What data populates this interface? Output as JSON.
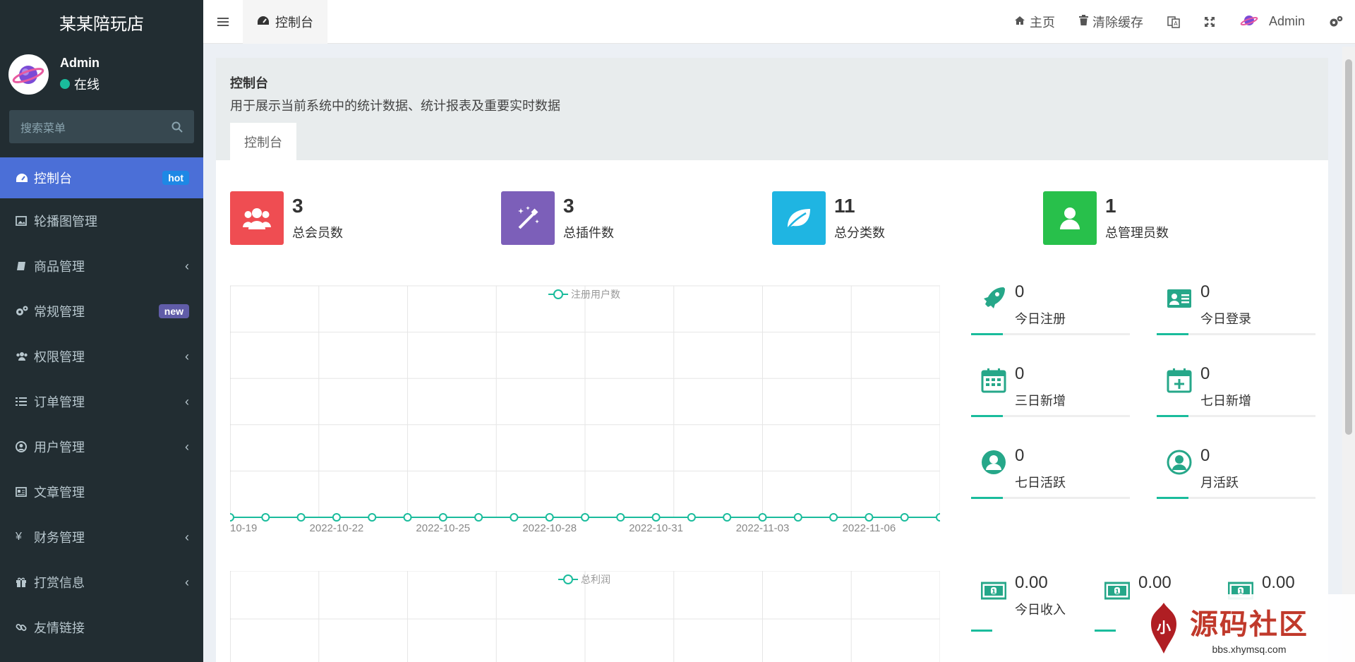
{
  "app": {
    "title": "某某陪玩店"
  },
  "user": {
    "name": "Admin",
    "status": "在线"
  },
  "search": {
    "placeholder": "搜索菜单"
  },
  "sidebar": {
    "items": [
      {
        "label": "控制台",
        "badge": "hot",
        "icon": "dashboard-icon",
        "active": true
      },
      {
        "label": "轮播图管理",
        "icon": "image-icon"
      },
      {
        "label": "商品管理",
        "icon": "book-icon",
        "chevron": "‹"
      },
      {
        "label": "常规管理",
        "badge": "new",
        "icon": "cogs-icon"
      },
      {
        "label": "权限管理",
        "icon": "users-icon",
        "chevron": "‹"
      },
      {
        "label": "订单管理",
        "icon": "list-icon",
        "chevron": "‹"
      },
      {
        "label": "用户管理",
        "icon": "user-circle-icon",
        "chevron": "‹"
      },
      {
        "label": "文章管理",
        "icon": "newspaper-icon"
      },
      {
        "label": "财务管理",
        "icon": "yen-icon",
        "chevron": "‹"
      },
      {
        "label": "打赏信息",
        "icon": "gift-icon",
        "chevron": "‹"
      },
      {
        "label": "友情链接",
        "icon": "link-icon"
      }
    ]
  },
  "topbar": {
    "tab": "控制台",
    "home": "主页",
    "clear_cache": "清除缓存",
    "user": "Admin"
  },
  "page": {
    "title": "控制台",
    "description": "用于展示当前系统中的统计数据、统计报表及重要实时数据",
    "inner_tab": "控制台"
  },
  "stats": [
    {
      "value": "3",
      "label": "总会员数",
      "color": "#dd4b39",
      "icon": "users-icon"
    },
    {
      "value": "3",
      "label": "总插件数",
      "color": "#605ca8",
      "icon": "magic-icon"
    },
    {
      "value": "11",
      "label": "总分类数",
      "color": "#00a7d0",
      "icon": "leaf-icon"
    },
    {
      "value": "1",
      "label": "总管理员数",
      "color": "#00a65a",
      "icon": "user-icon"
    }
  ],
  "mini_stats": [
    {
      "value": "0",
      "label": "今日注册",
      "icon": "rocket-icon"
    },
    {
      "value": "0",
      "label": "今日登录",
      "icon": "id-card-icon"
    },
    {
      "value": "0",
      "label": "三日新增",
      "icon": "calendar-icon"
    },
    {
      "value": "0",
      "label": "七日新增",
      "icon": "calendar-plus-icon"
    },
    {
      "value": "0",
      "label": "七日活跃",
      "icon": "user-circle-icon"
    },
    {
      "value": "0",
      "label": "月活跃",
      "icon": "user-circle-o-icon"
    }
  ],
  "money_stats": [
    {
      "value": "0.00",
      "label": "今日收入",
      "icon": "money-icon"
    },
    {
      "value": "0.00",
      "label": "",
      "icon": "money-icon"
    },
    {
      "value": "0.00",
      "label": "",
      "icon": "money-icon"
    }
  ],
  "chart_data": [
    {
      "type": "line",
      "legend": "注册用户数",
      "series": [
        {
          "name": "注册用户数",
          "values": [
            0,
            0,
            0,
            0,
            0,
            0,
            0,
            0,
            0,
            0,
            0,
            0,
            0,
            0,
            0,
            0,
            0,
            0,
            0,
            0,
            0
          ]
        }
      ],
      "x_tick_labels": [
        "10-19",
        "2022-10-22",
        "2022-10-25",
        "2022-10-28",
        "2022-10-31",
        "2022-11-03",
        "2022-11-06"
      ],
      "ylim": [
        0,
        5
      ],
      "grid": true,
      "color": "#1abc9c"
    },
    {
      "type": "line",
      "legend": "总利润",
      "series": [
        {
          "name": "总利润",
          "values": []
        }
      ],
      "grid": true,
      "color": "#1abc9c"
    }
  ],
  "watermark": {
    "title": "源码社区",
    "url": "bbs.xhymsq.com"
  }
}
